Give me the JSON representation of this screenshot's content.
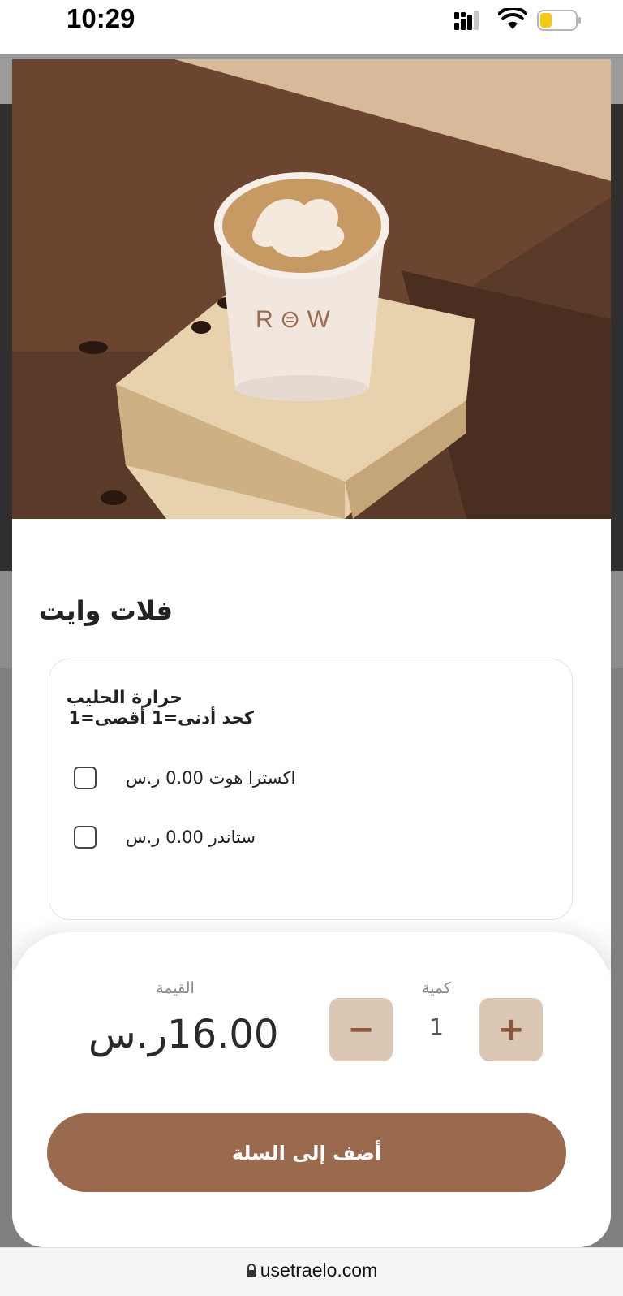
{
  "status_bar": {
    "time": "10:29"
  },
  "product": {
    "title": "فلات وايت"
  },
  "option_group": {
    "title": "حرارة الحليب",
    "rule": "كحد أدنى=1 أقصى=1",
    "options": [
      {
        "label": "اكسترا هوت 0.00 ر.س",
        "checked": false
      },
      {
        "label": "ستاندر 0.00 ر.س",
        "checked": false
      }
    ]
  },
  "price": {
    "caption": "القيمة",
    "value": "16.00ر.س"
  },
  "quantity": {
    "caption": "كمية",
    "value": "1",
    "minus": "−",
    "plus": "+"
  },
  "add_to_cart": {
    "label": "أضف إلى السلة"
  },
  "browser": {
    "url": "usetraelo.com"
  },
  "colors": {
    "accent": "#9a6a4e",
    "stepper_bg": "#dcc6b4",
    "stepper_glyph": "#8b5a3c"
  },
  "icons": [
    "signal-icon",
    "wifi-icon",
    "battery-icon",
    "lock-icon"
  ]
}
